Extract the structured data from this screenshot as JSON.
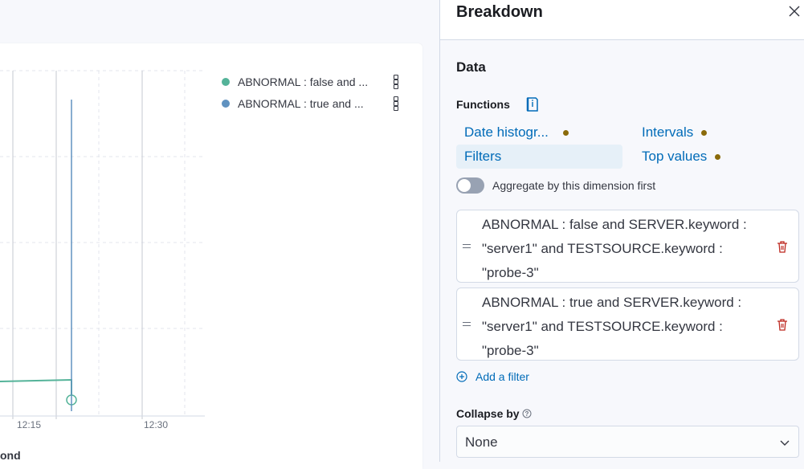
{
  "chart": {
    "legend": [
      {
        "label": "ABNORMAL : false and ...",
        "color": "#54b399"
      },
      {
        "label": "ABNORMAL : true and ...",
        "color": "#6092c0"
      }
    ],
    "x_ticks": [
      "12:15",
      "12:30"
    ],
    "x_axis_title": "ond"
  },
  "flyout": {
    "title": "Breakdown",
    "section_title": "Data",
    "functions_label": "Functions",
    "functions": [
      {
        "label": "Date histogr...",
        "has_dot": true,
        "selected": false
      },
      {
        "label": "Intervals",
        "has_dot": true,
        "selected": false
      },
      {
        "label": "Filters",
        "has_dot": false,
        "selected": true
      },
      {
        "label": "Top values",
        "has_dot": true,
        "selected": false
      }
    ],
    "toggle_label": "Aggregate by this dimension first",
    "toggle_on": false,
    "filters": [
      {
        "line1": "ABNORMAL : false and SERVER.keyword :",
        "line2": "\"server1\" and TESTSOURCE.keyword :",
        "line3": "\"probe-3\""
      },
      {
        "line1": "ABNORMAL : true and SERVER.keyword :",
        "line2": "\"server1\" and TESTSOURCE.keyword :",
        "line3": "\"probe-3\""
      }
    ],
    "add_filter_label": "Add a filter",
    "collapse_label": "Collapse by",
    "collapse_value": "None"
  },
  "colors": {
    "link": "#006bb8",
    "series_false": "#54b399",
    "series_true": "#6092c0",
    "delete": "#bd271e",
    "dot": "#8a6a0a"
  }
}
